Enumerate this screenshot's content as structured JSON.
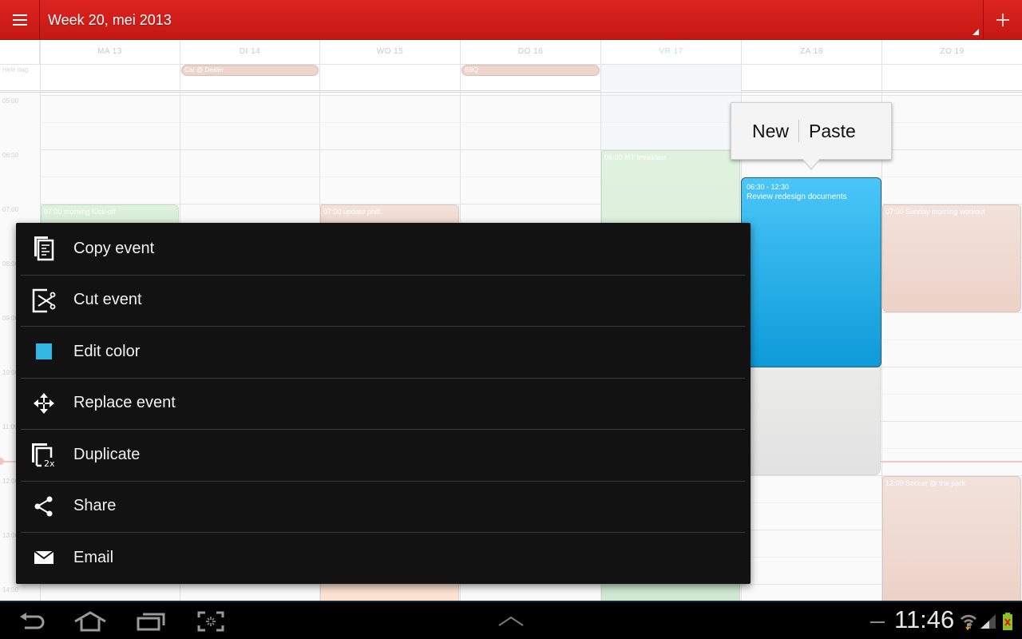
{
  "actionbar": {
    "menu_icon": "hamburger-menu-icon",
    "title": "Week 20, mei 2013",
    "add_icon": "plus-icon",
    "color": "#d01e1a"
  },
  "calendar": {
    "allday_label": "Hele dag",
    "days": [
      {
        "label": "MA 13",
        "today": false
      },
      {
        "label": "DI 14",
        "today": false
      },
      {
        "label": "WO 15",
        "today": false
      },
      {
        "label": "DO 16",
        "today": false
      },
      {
        "label": "VR 17",
        "today": true
      },
      {
        "label": "ZA 18",
        "today": false
      },
      {
        "label": "ZO 19",
        "today": false
      }
    ],
    "hours": [
      "05:00",
      "06:00",
      "07:00",
      "08:00",
      "09:00",
      "10:00",
      "11:00",
      "12:00",
      "13:00",
      "14:00"
    ],
    "allday_events": [
      {
        "title": "Car @ Dealer",
        "day": "DI 14"
      },
      {
        "title": "BBQ",
        "day": "DO 16"
      }
    ],
    "events": [
      {
        "title": "07:00 morning Kick-off",
        "day": "MA 13",
        "color": "green"
      },
      {
        "title": "07:00 update phill",
        "day": "WO 15",
        "color": "peach"
      },
      {
        "title": "06:00 MT breakfast",
        "day": "VR 17",
        "color": "green"
      },
      {
        "title": "07:00 Sunday morning workout",
        "day": "ZO 19",
        "color": "peach"
      },
      {
        "title": "12:00 Soccer @ the park",
        "day": "ZO 19",
        "color": "peach"
      }
    ],
    "selected_event": {
      "time": "06:30 - 12:30",
      "title": "Review redesign documents",
      "day": "ZA 18",
      "color": "#29b4ee"
    }
  },
  "popup": {
    "new_label": "New",
    "paste_label": "Paste"
  },
  "context_menu": {
    "items": [
      {
        "label": "Copy event",
        "icon": "copy-icon"
      },
      {
        "label": "Cut event",
        "icon": "cut-icon"
      },
      {
        "label": "Edit color",
        "icon": "color-swatch-icon",
        "color": "#33b5e5"
      },
      {
        "label": "Replace event",
        "icon": "move-icon"
      },
      {
        "label": "Duplicate",
        "icon": "duplicate-icon",
        "badge": "2x"
      },
      {
        "label": "Share",
        "icon": "share-icon"
      },
      {
        "label": "Email",
        "icon": "email-icon"
      }
    ]
  },
  "system_bar": {
    "clock": "11:46",
    "nav_icons": [
      "back-icon",
      "home-icon",
      "recent-apps-icon",
      "screenshot-icon"
    ],
    "status_icons": [
      "wifi-icon",
      "signal-icon",
      "battery-icon"
    ]
  }
}
